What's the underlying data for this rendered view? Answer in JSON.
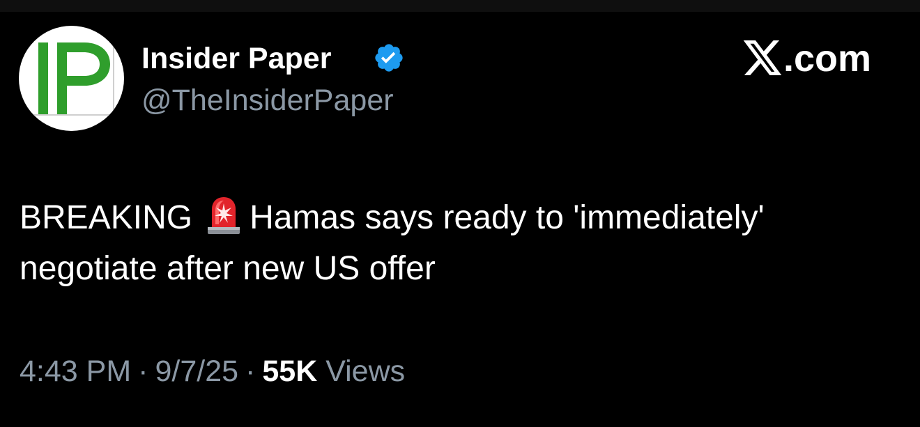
{
  "account": {
    "avatar_text": "IP",
    "display_name": "Insider Paper",
    "handle": "@TheInsiderPaper",
    "verified_icon": "verified-badge-icon",
    "avatar_color": "#2f9e2c"
  },
  "site_label": ".com",
  "tweet": {
    "text_line1_prefix": "BREAKING",
    "emoji": "siren-icon",
    "text_line1_suffix": "Hamas says ready to 'immediately'",
    "text_line2": "negotiate after new US offer"
  },
  "meta": {
    "time": "4:43 PM",
    "separator": "·",
    "date": "9/7/25",
    "views_count": "55K",
    "views_label": "Views"
  },
  "colors": {
    "background": "#000000",
    "primary_text": "#ffffff",
    "secondary_text": "#8b98a5",
    "verified_blue": "#1d9bf0"
  }
}
